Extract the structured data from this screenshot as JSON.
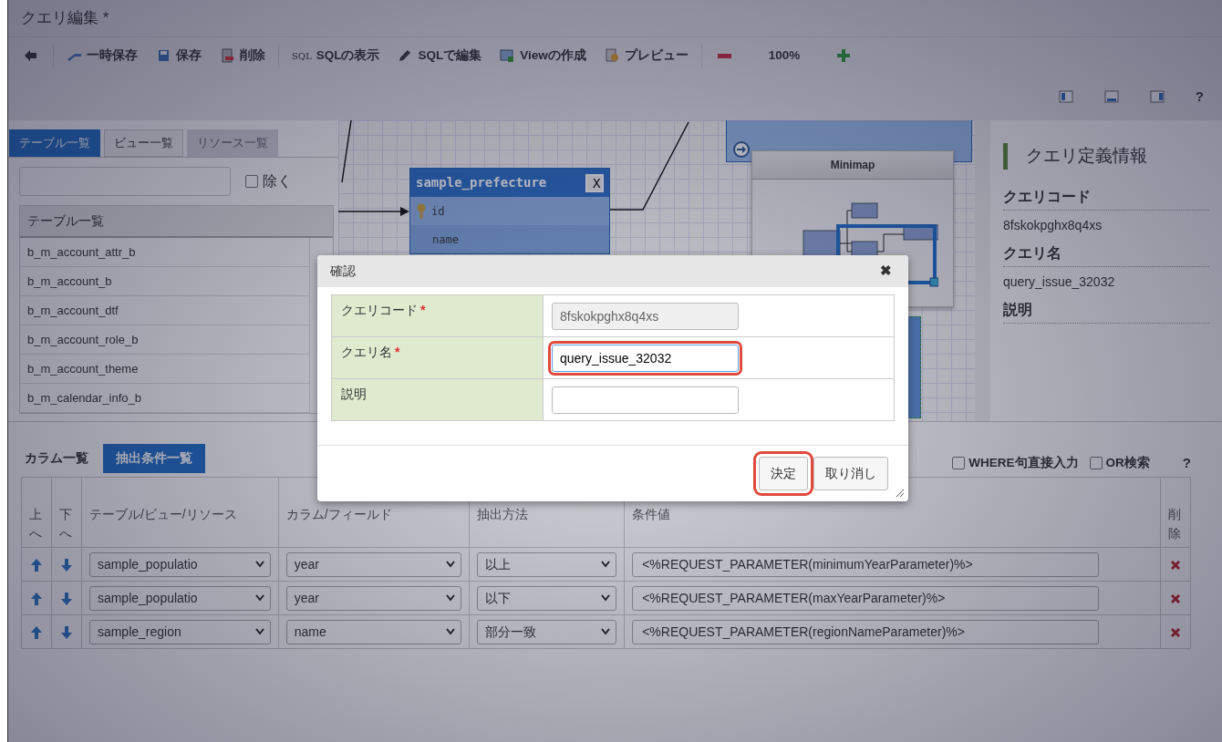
{
  "window": {
    "title": "クエリ編集 *"
  },
  "toolbar": {
    "groups": [
      [
        {
          "kind": "icon"
        }
      ],
      [
        {
          "kind": "button",
          "label": "一時保存"
        },
        {
          "kind": "button",
          "label": "保存"
        },
        {
          "kind": "button",
          "label": "削除"
        }
      ],
      [
        {
          "kind": "text-icon",
          "icon_text": "SQL",
          "label": "SQLの表示"
        },
        {
          "kind": "button",
          "label": "SQLで編集"
        },
        {
          "kind": "button",
          "label": "Viewの作成"
        },
        {
          "kind": "button",
          "label": "プレビュー"
        }
      ],
      [
        {
          "kind": "icon"
        },
        {
          "kind": "zoom",
          "label": "100%"
        },
        {
          "kind": "icon"
        }
      ]
    ],
    "help": "?"
  },
  "left_panel": {
    "tabs": [
      {
        "label": "テーブル一覧",
        "selected": true,
        "disabled": false
      },
      {
        "label": "ビュー一覧",
        "selected": false,
        "disabled": false
      },
      {
        "label": "リソース一覧",
        "selected": false,
        "disabled": true
      }
    ],
    "exclude": {
      "label": "除く",
      "checked": false
    },
    "table_list": {
      "header": "テーブル一覧",
      "items": [
        "b_m_account_attr_b",
        "b_m_account_b",
        "b_m_account_dtf",
        "b_m_account_role_b",
        "b_m_account_theme",
        "b_m_calendar_info_b"
      ]
    }
  },
  "canvas": {
    "nodes": [
      {
        "title": "sample_prefecture",
        "close": "X",
        "columns": [
          {
            "name": "id",
            "key": true
          },
          {
            "name": "name",
            "key": false
          }
        ]
      }
    ],
    "minimap": {
      "title": "Minimap"
    }
  },
  "right_panel": {
    "heading": "クエリ定義情報",
    "fields": [
      {
        "label": "クエリコード",
        "value": "8fskokpghx8q4xs"
      },
      {
        "label": "クエリ名",
        "value": "query_issue_32032"
      },
      {
        "label": "説明"
      }
    ]
  },
  "bottom": {
    "tabs": [
      {
        "label": "カラム一覧",
        "selected": false
      },
      {
        "label": "抽出条件一覧",
        "selected": true
      }
    ],
    "options": [
      {
        "label": "WHERE句直接入力",
        "checked": false
      },
      {
        "label": "OR検索",
        "checked": false
      }
    ],
    "help": "?",
    "columns": [
      "上へ",
      "下へ",
      "テーブル/ビュー/リソース",
      "カラム/フィールド",
      "抽出方法",
      "条件値",
      "削除"
    ],
    "rows": [
      {
        "table": "sample_populatio",
        "field": "year",
        "method": "以上",
        "value": "<%REQUEST_PARAMETER(minimumYearParameter)%>"
      },
      {
        "table": "sample_populatio",
        "field": "year",
        "method": "以下",
        "value": "<%REQUEST_PARAMETER(maxYearParameter)%>"
      },
      {
        "table": "sample_region",
        "field": "name",
        "method": "部分一致",
        "value": "<%REQUEST_PARAMETER(regionNameParameter)%>"
      }
    ]
  },
  "dialog": {
    "title": "確認",
    "close": "✖",
    "fields": [
      {
        "label": "クエリコード",
        "required_mark": "*",
        "value": "8fskokpghx8q4xs",
        "disabled": true,
        "highlighted": false
      },
      {
        "label": "クエリ名",
        "required_mark": "*",
        "value": "query_issue_32032",
        "disabled": false,
        "highlighted": true
      },
      {
        "label": "説明",
        "disabled": false,
        "highlighted": false
      }
    ],
    "buttons": [
      {
        "label": "決定",
        "highlighted": true
      },
      {
        "label": "取り消し",
        "highlighted": false
      }
    ]
  }
}
